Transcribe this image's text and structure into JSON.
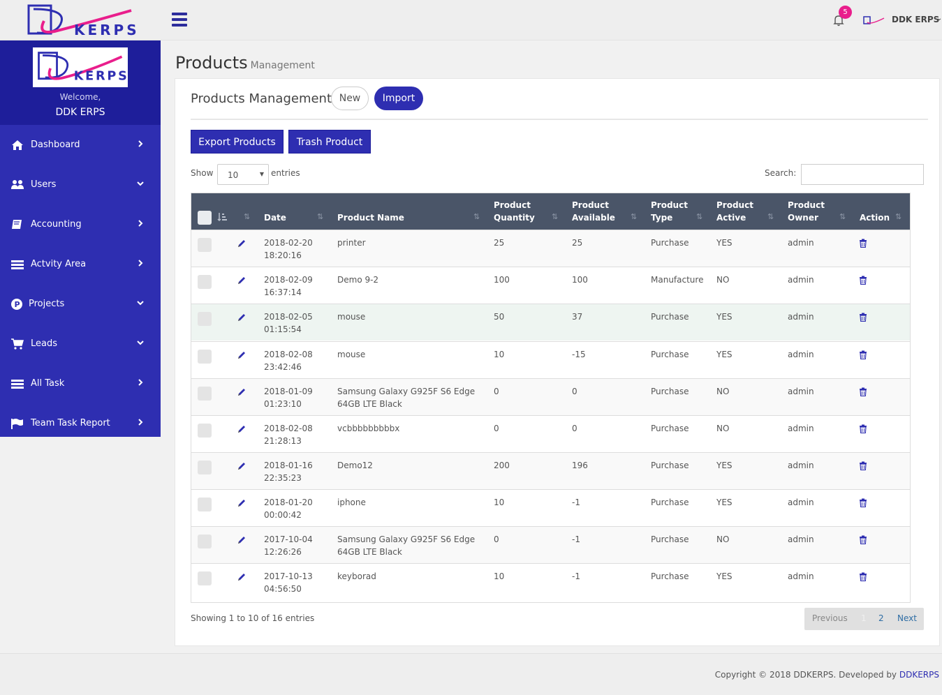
{
  "header": {
    "brand": "KERPS",
    "notifications_count": "5",
    "user_name": "DDK ERPS"
  },
  "sidebar": {
    "logo_text": "KERPS",
    "welcome": "Welcome,",
    "user": "DDK ERPS",
    "items": [
      {
        "label": "Dashboard",
        "icon": "home-icon",
        "caret": "right"
      },
      {
        "label": "Users",
        "icon": "users-icon",
        "caret": "down"
      },
      {
        "label": "Accounting",
        "icon": "book-icon",
        "caret": "right"
      },
      {
        "label": "Actvity Area",
        "icon": "list-icon",
        "caret": "right"
      },
      {
        "label": "Projects",
        "icon": "p-circle-icon",
        "caret": "down"
      },
      {
        "label": "Leads",
        "icon": "cart-icon",
        "caret": "down"
      },
      {
        "label": "All Task",
        "icon": "list-icon",
        "caret": "right"
      },
      {
        "label": "Team Task Report",
        "icon": "flag-icon",
        "caret": "right"
      }
    ]
  },
  "page": {
    "title": "Products",
    "subtitle": "Management"
  },
  "panel": {
    "title": "Products Management",
    "new_label": "New",
    "import_label": "Import",
    "export_label": "Export Products",
    "trash_label": "Trash Product"
  },
  "table_controls": {
    "show_label": "Show",
    "page_size": "10",
    "entries_label": "entries",
    "search_label": "Search:",
    "search_value": ""
  },
  "table": {
    "headers": {
      "date": "Date",
      "name": "Product Name",
      "qty_1": "Product",
      "qty_2": "Quantity",
      "avail_1": "Product",
      "avail_2": "Available",
      "type_1": "Product",
      "type_2": "Type",
      "active_1": "Product",
      "active_2": "Active",
      "owner_1": "Product",
      "owner_2": "Owner",
      "action": "Action"
    },
    "rows": [
      {
        "date": "2018-02-20",
        "time": "18:20:16",
        "name_1": "printer",
        "name_2": "",
        "qty": "25",
        "avail": "25",
        "type": "Purchase",
        "active": "YES",
        "owner": "admin"
      },
      {
        "date": "2018-02-09",
        "time": "16:37:14",
        "name_1": "Demo 9-2",
        "name_2": "",
        "qty": "100",
        "avail": "100",
        "type": "Manufacture",
        "active": "NO",
        "owner": "admin"
      },
      {
        "date": "2018-02-05",
        "time": "01:15:54",
        "name_1": "mouse",
        "name_2": "",
        "qty": "50",
        "avail": "37",
        "type": "Purchase",
        "active": "YES",
        "owner": "admin"
      },
      {
        "date": "2018-02-08",
        "time": "23:42:46",
        "name_1": "mouse",
        "name_2": "",
        "qty": "10",
        "avail": "-15",
        "type": "Purchase",
        "active": "YES",
        "owner": "admin"
      },
      {
        "date": "2018-01-09",
        "time": "01:23:10",
        "name_1": "Samsung Galaxy G925F S6 Edge",
        "name_2": "64GB LTE Black",
        "qty": "0",
        "avail": "0",
        "type": "Purchase",
        "active": "NO",
        "owner": "admin"
      },
      {
        "date": "2018-02-08",
        "time": "21:28:13",
        "name_1": "vcbbbbbbbbbx",
        "name_2": "",
        "qty": "0",
        "avail": "0",
        "type": "Purchase",
        "active": "NO",
        "owner": "admin"
      },
      {
        "date": "2018-01-16",
        "time": "22:35:23",
        "name_1": "Demo12",
        "name_2": "",
        "qty": "200",
        "avail": "196",
        "type": "Purchase",
        "active": "YES",
        "owner": "admin"
      },
      {
        "date": "2018-01-20",
        "time": "00:00:42",
        "name_1": "iphone",
        "name_2": "",
        "qty": "10",
        "avail": "-1",
        "type": "Purchase",
        "active": "YES",
        "owner": "admin"
      },
      {
        "date": "2017-10-04",
        "time": "12:26:26",
        "name_1": "Samsung Galaxy G925F S6 Edge",
        "name_2": "64GB LTE Black",
        "qty": "0",
        "avail": "-1",
        "type": "Purchase",
        "active": "NO",
        "owner": "admin"
      },
      {
        "date": "2017-10-13",
        "time": "04:56:50",
        "name_1": "keyborad",
        "name_2": "",
        "qty": "10",
        "avail": "-1",
        "type": "Purchase",
        "active": "YES",
        "owner": "admin"
      }
    ]
  },
  "pagination": {
    "summary": "Showing 1 to 10 of 16 entries",
    "previous": "Previous",
    "page_1": "1",
    "page_2": "2",
    "next": "Next"
  },
  "footer": {
    "text": "Copyright © 2018 DDKERPS. Developed by",
    "link": "DDKERPS"
  },
  "colors": {
    "primary": "#2e2eb1",
    "sidebar": "#2e2eb1",
    "table_header": "#4a5568",
    "badge": "#e91e8c"
  }
}
